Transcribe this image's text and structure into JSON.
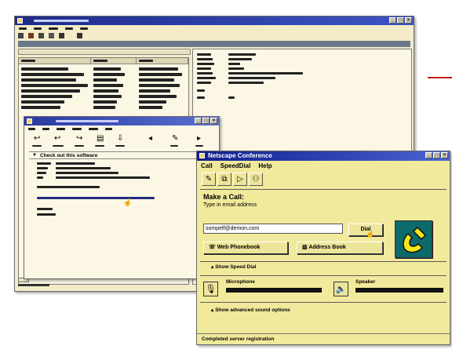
{
  "back_window": {
    "rows_left": [
      "",
      "",
      "",
      "",
      "",
      "",
      "",
      "",
      "",
      ""
    ],
    "rows_right": [
      "",
      "",
      "",
      "",
      "",
      "",
      "",
      "",
      "",
      ""
    ]
  },
  "mail_window": {
    "heading": "Check out this software"
  },
  "conf_window": {
    "title": "Netscape Conference",
    "menu": [
      "Call",
      "SpeedDial",
      "Help"
    ],
    "make_call_label": "Make a Call:",
    "email_prompt": "Type in email address",
    "email_value": "sompelf@demon.com",
    "dial_button": "Dial",
    "web_phonebook_button": "Web Phonebook",
    "address_book_button": "Address Book",
    "show_speed_dial": "Show Speed Dial",
    "microphone_label": "Microphone",
    "speaker_label": "Speaker",
    "advanced_options": "Show advanced sound options",
    "status": "Completed server registration"
  },
  "icons": {
    "phone": "phone-handset-icon",
    "mic": "microphone-icon",
    "speaker": "speaker-icon"
  },
  "colors": {
    "accent_yellow": "#f1ea9c",
    "title_blue": "#101f8c",
    "phone_tile": "#0c6a6a",
    "handset": "#f7e61a",
    "connector_red": "#c01818"
  }
}
